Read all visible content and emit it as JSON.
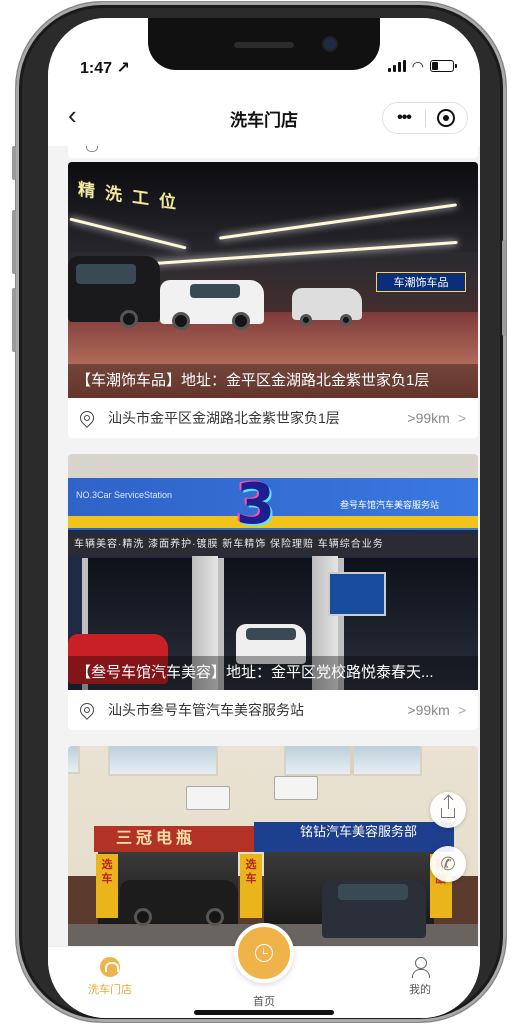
{
  "status_bar": {
    "time": "1:47 ↗"
  },
  "nav": {
    "back_icon": "‹",
    "title": "洗车门店",
    "more_icon": "•••"
  },
  "stores": [
    {
      "caption": "【车潮饰车品】地址：金平区金湖路北金紫世家负1层",
      "address": "汕头市金平区金湖路北金紫世家负1层",
      "distance": ">99km",
      "sign_text": "精洗工位",
      "shop_sign": "车潮饰车品"
    },
    {
      "caption": "【叁号车馆汽车美容】地址：金平区党校路悦泰春天...",
      "address": "汕头市叁号车管汽车美容服务站",
      "distance": ">99km",
      "logo_text": "3",
      "banner_left": "NO.3Car ServiceStation",
      "banner_right": "叁号车馆汽车美容服务站",
      "service_strip": "车辆美容·精洗  漆面养护·镀膜  新车精饰  保险理赔  车辆综合业务"
    },
    {
      "caption": "",
      "address": "",
      "distance": "",
      "sign_red": "三冠电瓶",
      "sign_blue": "铭钻汽车美容服务部"
    }
  ],
  "tabbar": {
    "wash_label": "洗车门店",
    "home_label": "首页",
    "mine_label": "我的"
  },
  "colors": {
    "accent": "#f0b34a",
    "caption_bg": "rgba(0,0,0,0.35)"
  }
}
